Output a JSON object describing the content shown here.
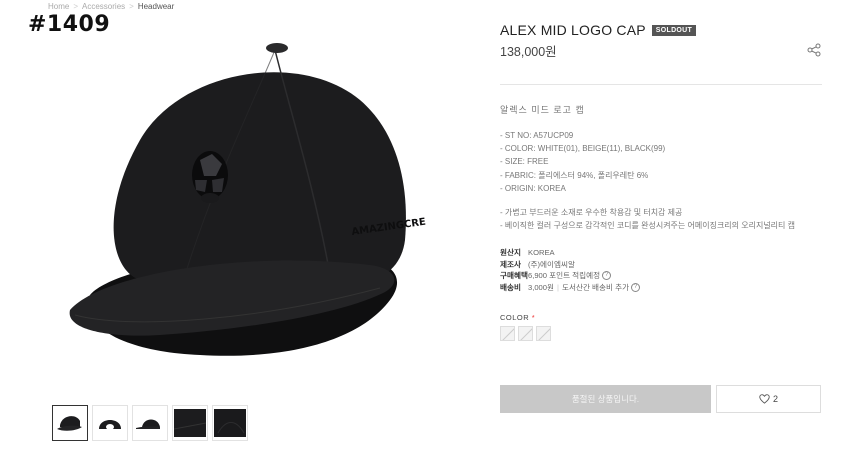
{
  "breadcrumb": {
    "home": "Home",
    "category": "Accessories",
    "current": "Headwear"
  },
  "tag": "#1409",
  "product": {
    "title": "ALEX MID LOGO CAP",
    "status_badge": "SOLDOUT",
    "price": "138,000원",
    "korean_name": "알렉스 미드 로고 캡",
    "specs": [
      "- ST NO: A57UCP09",
      "- COLOR: WHITE(01), BEIGE(11), BLACK(99)",
      "- SIZE: FREE",
      "- FABRIC: 폴리에스터 94%, 폴리우레탄 6%",
      "- ORIGIN: KOREA"
    ],
    "features": [
      "- 가볍고 부드러운 소재로 우수한 착용감 및 터치감 제공",
      "- 베이직한 컬러 구성으로 감각적인 코디를 완성시켜주는 어메이징크리의 오리지널리티 캡"
    ]
  },
  "meta": {
    "origin_label": "원산지",
    "origin_value": "KOREA",
    "maker_label": "제조사",
    "maker_value": "(주)에이엠씨알",
    "benefit_label": "구매혜택",
    "benefit_value": "6,900 포인트 적립예정",
    "shipping_label": "배송비",
    "shipping_value": "3,000원",
    "shipping_extra": "도서산간 배송비 추가"
  },
  "color": {
    "label": "COLOR",
    "required_mark": "*",
    "swatch_count": 3
  },
  "actions": {
    "soldout_label": "품절된 상품입니다.",
    "like_count": "2"
  },
  "colors": {
    "badge": "#555555",
    "soldout_button": "#c8c8c8",
    "cap": "#1c1c1e"
  },
  "thumbnails": [
    "front-view",
    "back-view",
    "side-view",
    "detail-view",
    "top-view"
  ]
}
